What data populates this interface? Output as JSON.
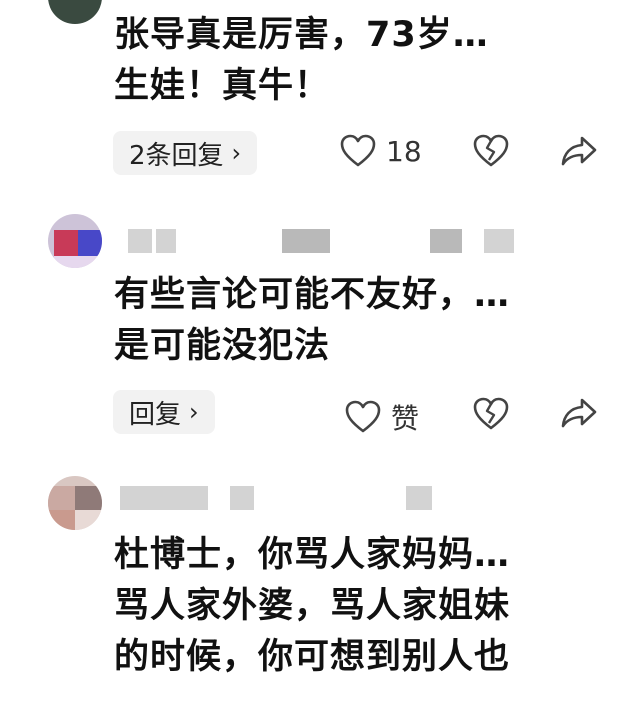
{
  "comments": [
    {
      "text": "张导真是厉害，73岁…\n生娃！真牛！",
      "reply_label": "2条回复",
      "like_count": "18",
      "icons": [
        "heart-outline",
        "heart-broken",
        "share-arrow"
      ]
    },
    {
      "text": "有些言论可能不友好，…\n是可能没犯法",
      "reply_label": "回复",
      "like_count": "赞",
      "icons": [
        "heart-outline",
        "heart-broken",
        "share-arrow"
      ]
    },
    {
      "text": "杜博士，你骂人家妈妈…\n骂人家外婆，骂人家姐妹\n的时候，你可想到别人也",
      "icons": []
    }
  ]
}
